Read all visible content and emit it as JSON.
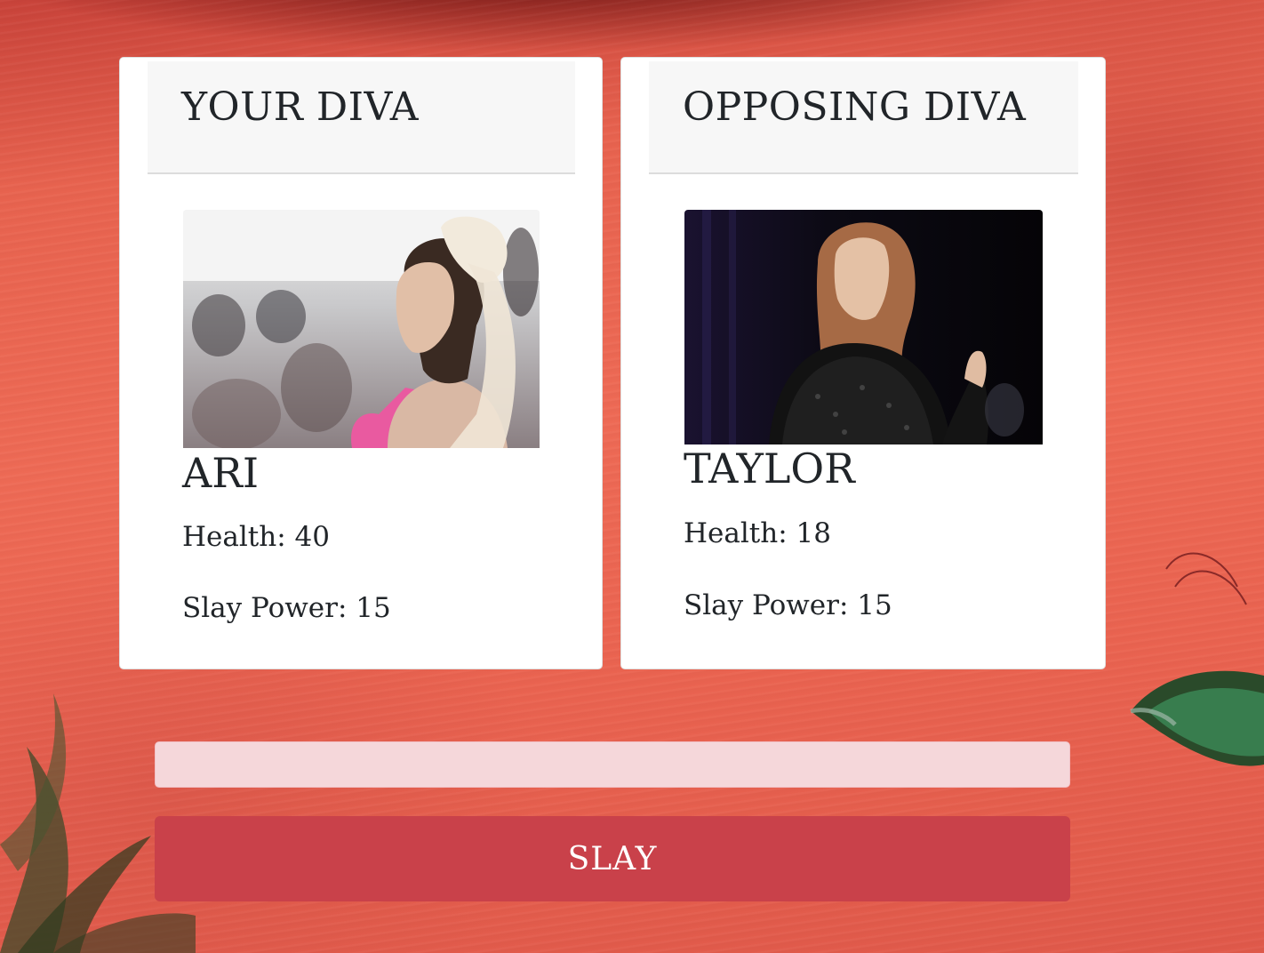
{
  "player": {
    "header": "YOUR DIVA",
    "name": "ARI",
    "health_label": "Health: 40",
    "slay_power_label": "Slay Power: 15"
  },
  "opponent": {
    "header": "OPPOSING DIVA",
    "name": "TAYLOR",
    "health_label": "Health: 18",
    "slay_power_label": "Slay Power: 15"
  },
  "message": "",
  "action": {
    "slay_label": "SLAY"
  },
  "colors": {
    "button": "#c9414a",
    "message_bg": "#f5d7da",
    "background": "#ee6a55"
  }
}
